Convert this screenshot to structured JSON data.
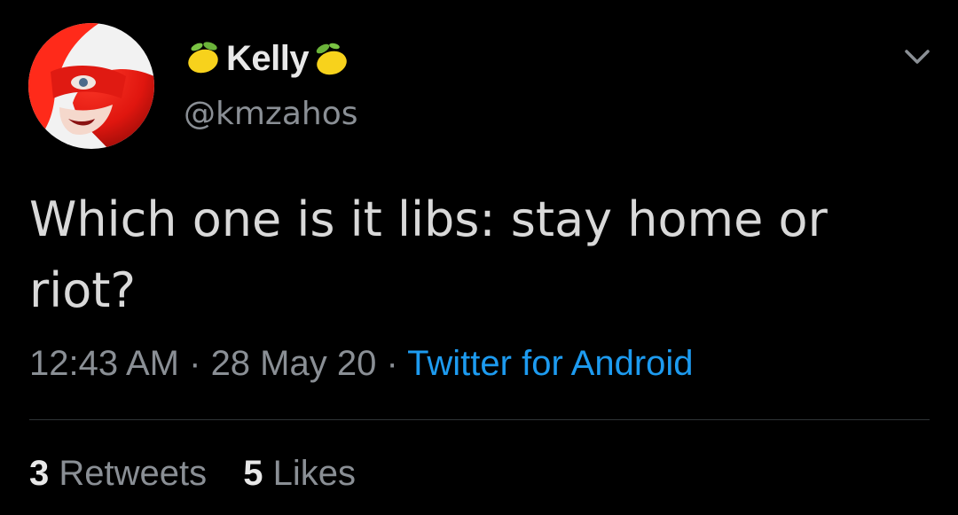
{
  "author": {
    "display_name": "Kelly",
    "handle": "@kmzahos",
    "name_prefix_icon": "lemon-icon",
    "name_suffix_icon": "lemon-icon"
  },
  "tweet": {
    "text": "Which one is it libs: stay home or riot?",
    "time": "12:43 AM",
    "date": "28 May 20",
    "separator": " · ",
    "source": "Twitter for Android"
  },
  "stats": {
    "retweets_count": "3",
    "retweets_label": "Retweets",
    "likes_count": "5",
    "likes_label": "Likes"
  },
  "colors": {
    "background": "#000000",
    "text_primary": "#d9d9d9",
    "text_secondary": "#8a8f95",
    "link": "#1d9bf0",
    "divider": "#2f3336"
  },
  "icons": {
    "menu": "chevron-down-icon",
    "avatar": "avatar"
  }
}
